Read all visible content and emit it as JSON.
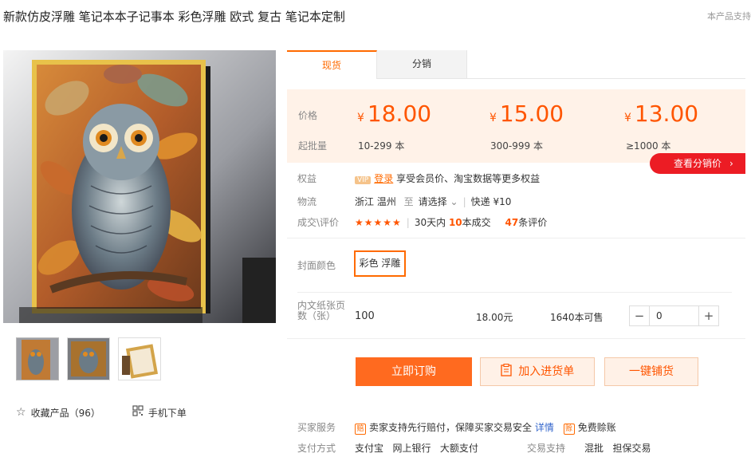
{
  "product": {
    "title": "新款仿皮浮雕 笔记本本子记事本 彩色浮雕 欧式 复古 笔记本定制",
    "report_link": "本产品支持"
  },
  "tabs": [
    "现货",
    "分销"
  ],
  "price_box": {
    "price_label": "价格",
    "moq_label": "起批量",
    "currency": "¥",
    "tiers": [
      {
        "price": "18.00",
        "range": "10-299 本"
      },
      {
        "price": "15.00",
        "range": "300-999 本"
      },
      {
        "price": "13.00",
        "range": "≥1000 本"
      }
    ],
    "dist_button": "查看分销价",
    "dist_chevron": "›"
  },
  "benefits": {
    "label": "权益",
    "vip": "VIP",
    "login": "登录",
    "text": "享受会员价、淘宝数据等更多权益"
  },
  "logistics": {
    "label": "物流",
    "origin": "浙江 温州",
    "to": "至",
    "select": "请选择",
    "express": "快递 ¥10"
  },
  "rating": {
    "label": "成交\\评价",
    "stars": "★★★★★",
    "sales_prefix": "30天内",
    "sales_count": "10",
    "sales_suffix": "本成交",
    "review_count": "47",
    "review_suffix": "条评价"
  },
  "cover": {
    "label": "封面颜色",
    "option": "彩色 浮雕"
  },
  "spec": {
    "label": "内文纸张页数（张）",
    "value": "100",
    "price": "18.00元",
    "stock": "1640本可售",
    "minus": "−",
    "plus": "+",
    "qty": "0"
  },
  "actions": {
    "buy": "立即订购",
    "cart": "加入进货单",
    "dropship": "一键铺货"
  },
  "sidebar": {
    "favorite": "收藏产品（96）",
    "mobile": "手机下单"
  },
  "services": {
    "buyer_label": "买家服务",
    "guarantee": "卖家支持先行赔付，保障买家交易安全",
    "detail": "详情",
    "free_comp": "免费赊账",
    "pay_label": "支付方式",
    "pay_methods": "支付宝   网上银行   大额支付",
    "trade_label": "交易支持",
    "trade_methods": "混批   担保交易"
  }
}
